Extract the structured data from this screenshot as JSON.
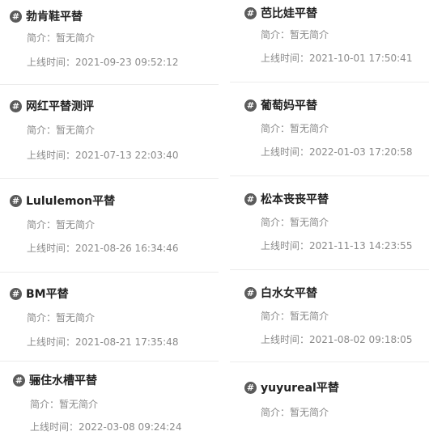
{
  "left": [
    {
      "title": "勃肯鞋平替",
      "intro": "简介：暂无简介",
      "online": "上线时间：2021-09-23 09:52:12"
    },
    {
      "title": "网红平替测评",
      "intro": "简介：暂无简介",
      "online": "上线时间：2021-07-13 22:03:40"
    },
    {
      "title": "Lululemon平替",
      "intro": "简介：暂无简介",
      "online": "上线时间：2021-08-26 16:34:46"
    },
    {
      "title": "BM平替",
      "intro": "简介：暂无简介",
      "online": "上线时间：2021-08-21 17:35:48"
    },
    {
      "title": "骊住水槽平替",
      "intro": "简介：暂无简介",
      "online": "上线时间：2022-03-08 09:24:24"
    }
  ],
  "right": [
    {
      "title": "芭比娃平替",
      "intro": "简介：暂无简介",
      "online": "上线时间：2021-10-01 17:50:41"
    },
    {
      "title": "葡萄妈平替",
      "intro": "简介：暂无简介",
      "online": "上线时间：2022-01-03 17:20:58"
    },
    {
      "title": "松本丧丧平替",
      "intro": "简介：暂无简介",
      "online": "上线时间：2021-11-13 14:23:55"
    },
    {
      "title": "白水女平替",
      "intro": "简介：暂无简介",
      "online": "上线时间：2021-08-02 09:18:05"
    },
    {
      "title": "yuyureal平替",
      "intro": "简介：暂无简介"
    }
  ],
  "hash_symbol": "#"
}
